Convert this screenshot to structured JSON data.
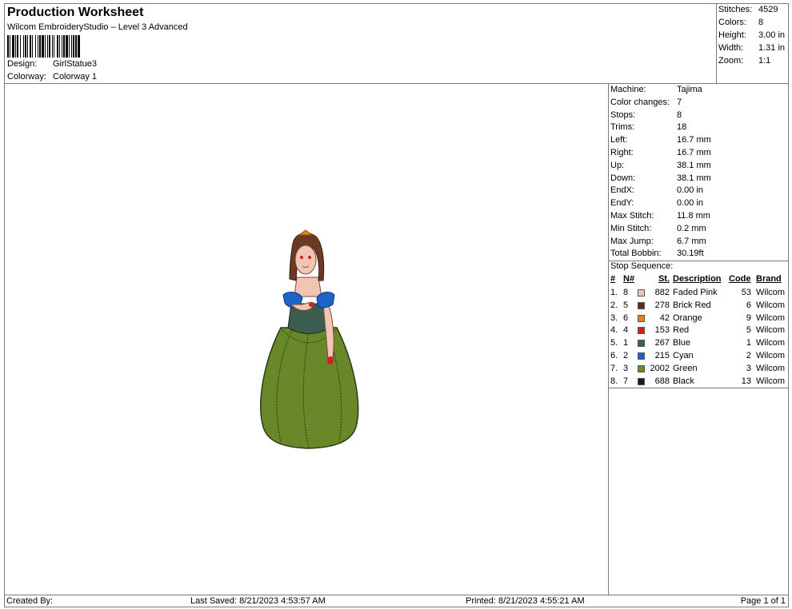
{
  "header": {
    "title": "Production Worksheet",
    "software": "Wilcom EmbroideryStudio – Level 3 Advanced",
    "design_label": "Design:",
    "design_value": "GirlStatue3",
    "colorway_label": "Colorway:",
    "colorway_value": "Colorway 1"
  },
  "summary": [
    {
      "label": "Stitches:",
      "value": "4529"
    },
    {
      "label": "Colors:",
      "value": "8"
    },
    {
      "label": "Height:",
      "value": "3.00 in"
    },
    {
      "label": "Width:",
      "value": "1.31 in"
    },
    {
      "label": "Zoom:",
      "value": "1:1"
    }
  ],
  "details": [
    {
      "label": "Machine:",
      "value": "Tajima"
    },
    {
      "label": "Color changes:",
      "value": "7"
    },
    {
      "label": "Stops:",
      "value": "8"
    },
    {
      "label": "Trims:",
      "value": "18"
    },
    {
      "label": "Left:",
      "value": "16.7 mm"
    },
    {
      "label": "Right:",
      "value": "16.7 mm"
    },
    {
      "label": "Up:",
      "value": "38.1 mm"
    },
    {
      "label": "Down:",
      "value": "38.1 mm"
    },
    {
      "label": "EndX:",
      "value": "0.00 in"
    },
    {
      "label": "EndY:",
      "value": "0.00 in"
    },
    {
      "label": "Max Stitch:",
      "value": "11.8 mm"
    },
    {
      "label": "Min Stitch:",
      "value": "0.2 mm"
    },
    {
      "label": "Max Jump:",
      "value": "6.7 mm"
    },
    {
      "label": "Total Bobbin:",
      "value": "30.19ft"
    }
  ],
  "stop_sequence": {
    "title": "Stop Sequence:",
    "headers": {
      "num": "#",
      "n": "N#",
      "st": "St.",
      "desc": "Description",
      "code": "Code",
      "brand": "Brand"
    },
    "rows": [
      {
        "num": "1.",
        "n": "8",
        "color": "#f2c4b4",
        "st": "882",
        "desc": "Faded Pink",
        "code": "53",
        "brand": "Wilcom"
      },
      {
        "num": "2.",
        "n": "5",
        "color": "#5a2e1a",
        "st": "278",
        "desc": "Brick Red",
        "code": "6",
        "brand": "Wilcom"
      },
      {
        "num": "3.",
        "n": "6",
        "color": "#e8821e",
        "st": "42",
        "desc": "Orange",
        "code": "9",
        "brand": "Wilcom"
      },
      {
        "num": "4.",
        "n": "4",
        "color": "#d42020",
        "st": "153",
        "desc": "Red",
        "code": "5",
        "brand": "Wilcom"
      },
      {
        "num": "5.",
        "n": "1",
        "color": "#3d5e50",
        "st": "267",
        "desc": "Blue",
        "code": "1",
        "brand": "Wilcom"
      },
      {
        "num": "6.",
        "n": "2",
        "color": "#1e64c8",
        "st": "215",
        "desc": "Cyan",
        "code": "2",
        "brand": "Wilcom"
      },
      {
        "num": "7.",
        "n": "3",
        "color": "#6b8a2a",
        "st": "2002",
        "desc": "Green",
        "code": "3",
        "brand": "Wilcom"
      },
      {
        "num": "8.",
        "n": "7",
        "color": "#1a1a1a",
        "st": "688",
        "desc": "Black",
        "code": "13",
        "brand": "Wilcom"
      }
    ]
  },
  "footer": {
    "created_by": "Created By:",
    "last_saved": "Last Saved: 8/21/2023 4:53:57 AM",
    "printed": "Printed: 8/21/2023 4:55:21 AM",
    "page": "Page 1 of 1"
  }
}
